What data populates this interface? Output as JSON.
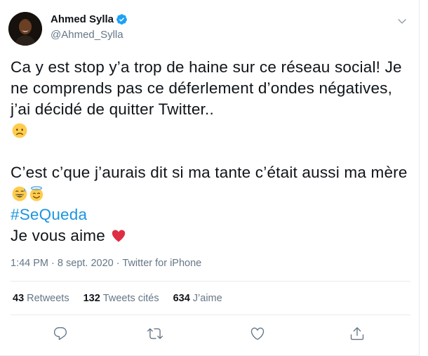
{
  "author": {
    "name": "Ahmed Sylla",
    "handle": "@Ahmed_Sylla",
    "verified": true
  },
  "tweet": {
    "line1": "Ca y est stop y’a trop de haine sur ce réseau social! Je ne comprends pas ce déferlement d’ondes négatives, j’ai décidé de quitter Twitter..",
    "line2": "C’est c’que j’aurais dit si ma tante c’était aussi ma mère",
    "hashtag": "#SeQueda",
    "line3": "Je vous aime",
    "emojis": [
      "disappointed-face-icon",
      "grinning-sweat-face-icon",
      "smiling-halo-face-icon",
      "red-heart-icon"
    ]
  },
  "meta": {
    "time": "1:44 PM",
    "separator1": "·",
    "date": "8 sept. 2020",
    "separator2": "·",
    "source": "Twitter for iPhone"
  },
  "stats": {
    "retweets_count": "43",
    "retweets_label": "Retweets",
    "quotes_count": "132",
    "quotes_label": "Tweets cités",
    "likes_count": "634",
    "likes_label": "J’aime"
  },
  "colors": {
    "link": "#1b95e0",
    "verified": "#1da1f2",
    "muted": "#657786",
    "heart": "#e0245e"
  }
}
